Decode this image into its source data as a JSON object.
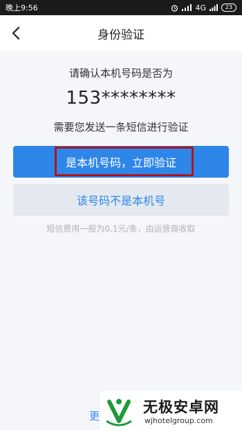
{
  "status_bar": {
    "time": "晚上9:56",
    "network": "4G",
    "battery": "23"
  },
  "header": {
    "title": "身份验证",
    "back_icon": "chevron-left-icon"
  },
  "verify": {
    "prompt": "请确认本机号码是否为",
    "phone_masked": "153********",
    "sms_notice": "需要您发送一条短信进行验证",
    "confirm_button": "是本机号码，立即验证",
    "deny_button": "该号码不是本机号",
    "fee_note": "短信费用一般为0.1元/条，由运营商收取",
    "more_link": "更换"
  },
  "watermark": {
    "title": "无极安卓网",
    "url": "wjhotelgroup.com"
  },
  "colors": {
    "accent": "#2f86e9",
    "highlight": "#b0141b",
    "secondary_bg": "#e4e9f0",
    "page_bg": "#f5f6fa"
  }
}
